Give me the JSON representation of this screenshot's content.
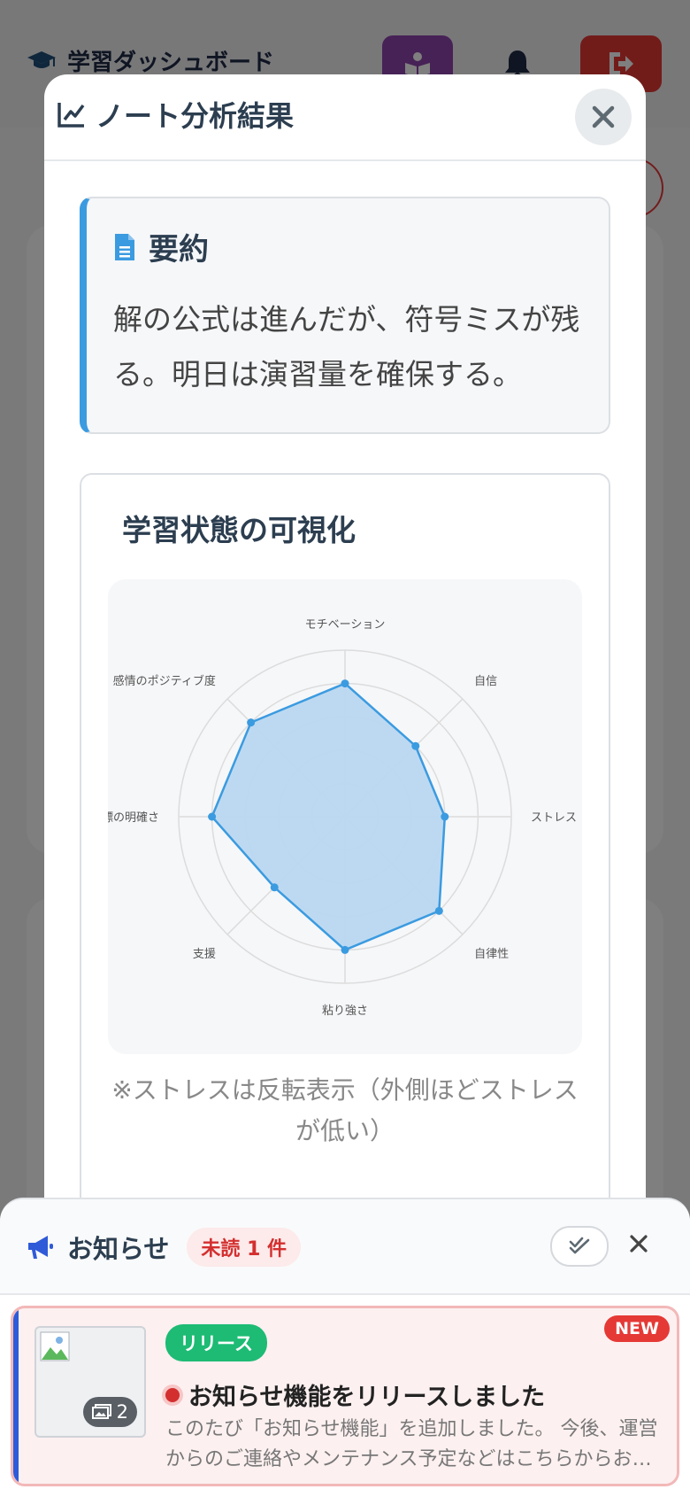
{
  "app": {
    "title": "学習ダッシュボード"
  },
  "modal": {
    "title": "ノート分析結果",
    "summary": {
      "heading": "要約",
      "text": "解の公式は進んだが、符号ミスが残る。明日は演習量を確保する。"
    },
    "visualization": {
      "heading": "学習状態の可視化",
      "note": "※ストレスは反転表示（外側ほどストレスが低い）"
    }
  },
  "chart_data": {
    "type": "radar",
    "axes": [
      "モチベーション",
      "自信",
      "ストレス（反転）",
      "自律性",
      "粘り強さ",
      "支援",
      "目標の明確さ",
      "感情のポジティブ度"
    ],
    "axis_labels_display": [
      "モチベーション",
      "自信",
      "ストレス（反転",
      "自律性",
      "粘り強さ",
      "支援",
      "目標の明確さ",
      "感情のポジティブ度"
    ],
    "values": [
      4,
      3,
      3,
      4,
      4,
      3,
      4,
      4
    ],
    "rmax": 5,
    "grid_levels": 5,
    "fill_color": "#b9d7f0",
    "line_color": "#3b9be0"
  },
  "notifications": {
    "title": "お知らせ",
    "unread_badge": "未読 1 件",
    "items": [
      {
        "tag": "リリース",
        "new_label": "NEW",
        "title": "お知らせ機能をリリースしました",
        "description": "このたび「お知らせ機能」を追加しました。 今後、運営からのご連絡やメンテナンス予定などはこちらからお知らせします。",
        "image_count": "2"
      }
    ]
  },
  "colors": {
    "accent_blue": "#3b9be0",
    "release_green": "#1dbb74",
    "alert_red": "#e53935",
    "purple": "#8e44ad"
  }
}
